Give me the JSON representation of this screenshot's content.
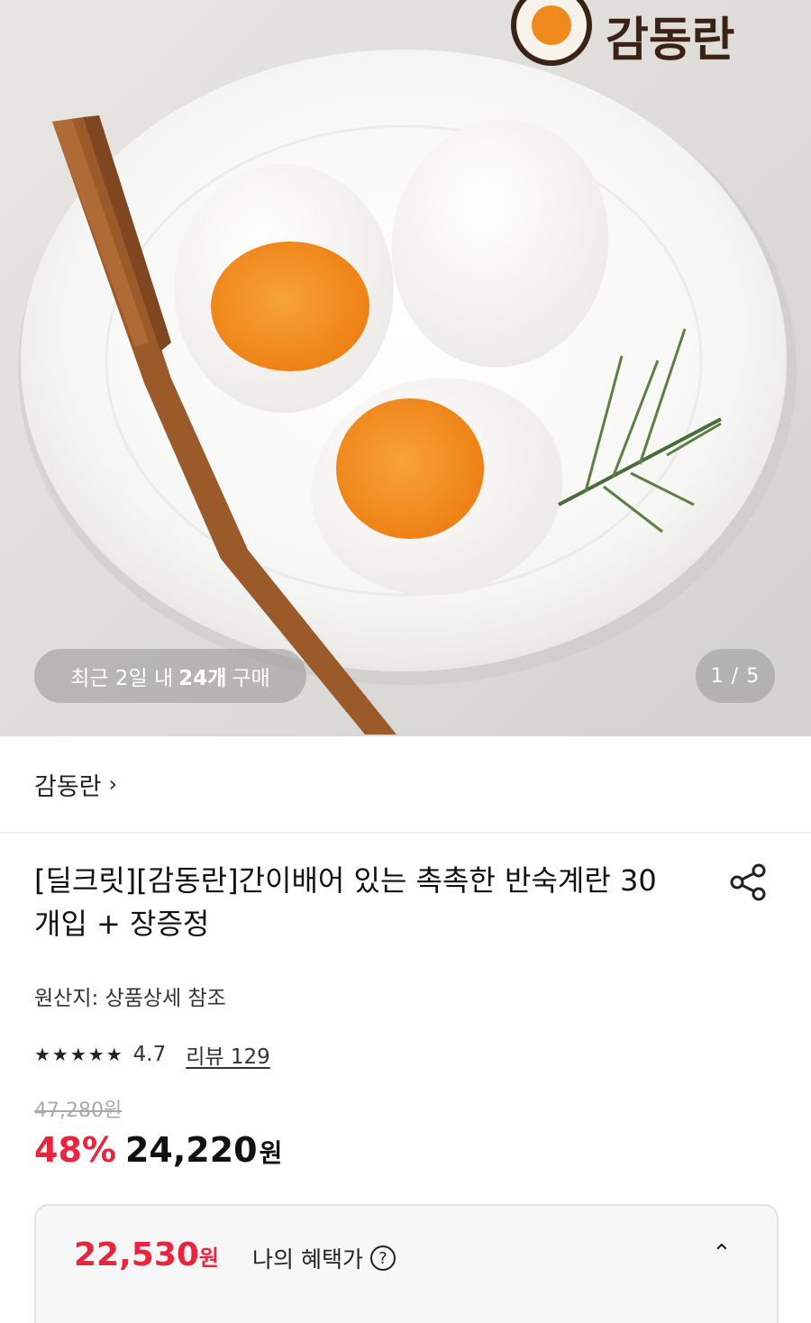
{
  "hero": {
    "logo_text": "감동란",
    "recent_prefix": "최근 2일 내",
    "recent_count": "24개",
    "recent_suffix": "구매",
    "pager": "1 / 5"
  },
  "brand": {
    "name": "감동란",
    "chevron": "›"
  },
  "product": {
    "title": "[딜크릿][감동란]간이배어 있는 촉촉한 반숙계란 30개입 + 장증정",
    "origin": "원산지: 상품상세 참조",
    "stars": "★★★★★",
    "rating": "4.7",
    "reviews": "리뷰 129",
    "original_price": "47,280원",
    "discount": "48%",
    "price": "24,220",
    "currency": "원"
  },
  "benefit": {
    "price": "22,530",
    "currency": "원",
    "label": "나의 혜택가",
    "help": "?",
    "chevron": "⌃"
  },
  "colors": {
    "accent": "#e8243f",
    "yolk": "#f08a1c"
  },
  "icons": [
    "share-icon",
    "help-icon",
    "chevron-up-icon",
    "chevron-right-icon",
    "star-icon"
  ]
}
